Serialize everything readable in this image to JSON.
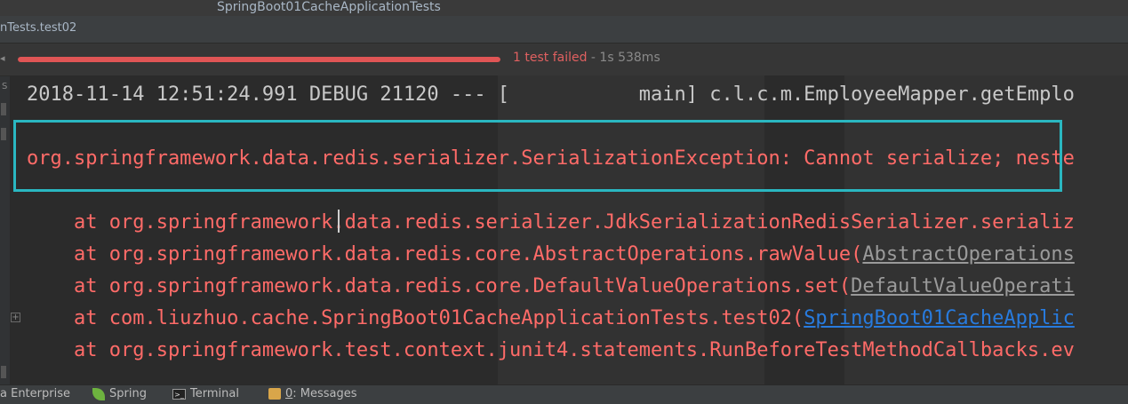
{
  "window": {
    "title": "SpringBoot01CacheApplicationTests",
    "tab": "nTests.test02"
  },
  "run": {
    "progress_fraction": 1.0,
    "failed_text": "1 test failed",
    "time_text": " - 1s 538ms",
    "bar_color": "#e05555"
  },
  "console": {
    "debug_line": "2018-11-14 12:51:24.991 DEBUG 21120 --- [           main] c.l.c.m.EmployeeMapper.getEmplo",
    "exception_line": "org.springframework.data.redis.serializer.SerializationException: Cannot serialize; neste",
    "stack": [
      {
        "text": "    at org.springframework.data.redis.serializer.JdkSerializationRedisSerializer.serializ",
        "link": ""
      },
      {
        "text": "    at org.springframework.data.redis.core.AbstractOperations.rawValue(",
        "link": "AbstractOperations"
      },
      {
        "text": "    at org.springframework.data.redis.core.DefaultValueOperations.set(",
        "link": "DefaultValueOperati"
      },
      {
        "text": "    at com.liuzhuo.cache.SpringBoot01CacheApplicationTests.test02(",
        "link": "SpringBoot01CacheApplic"
      },
      {
        "text": "    at org.springframework.test.context.junit4.statements.RunBeforeTestMethodCallbacks.ev",
        "link": ""
      }
    ]
  },
  "statusbar": {
    "enterprise": "a Enterprise",
    "spring": "Spring",
    "terminal": "Terminal",
    "messages_num": "0",
    "messages_label": ": Messages"
  },
  "colors": {
    "accent_box": "#2ab7c1",
    "error_text": "#ff6b68",
    "link_blue": "#287bde"
  }
}
